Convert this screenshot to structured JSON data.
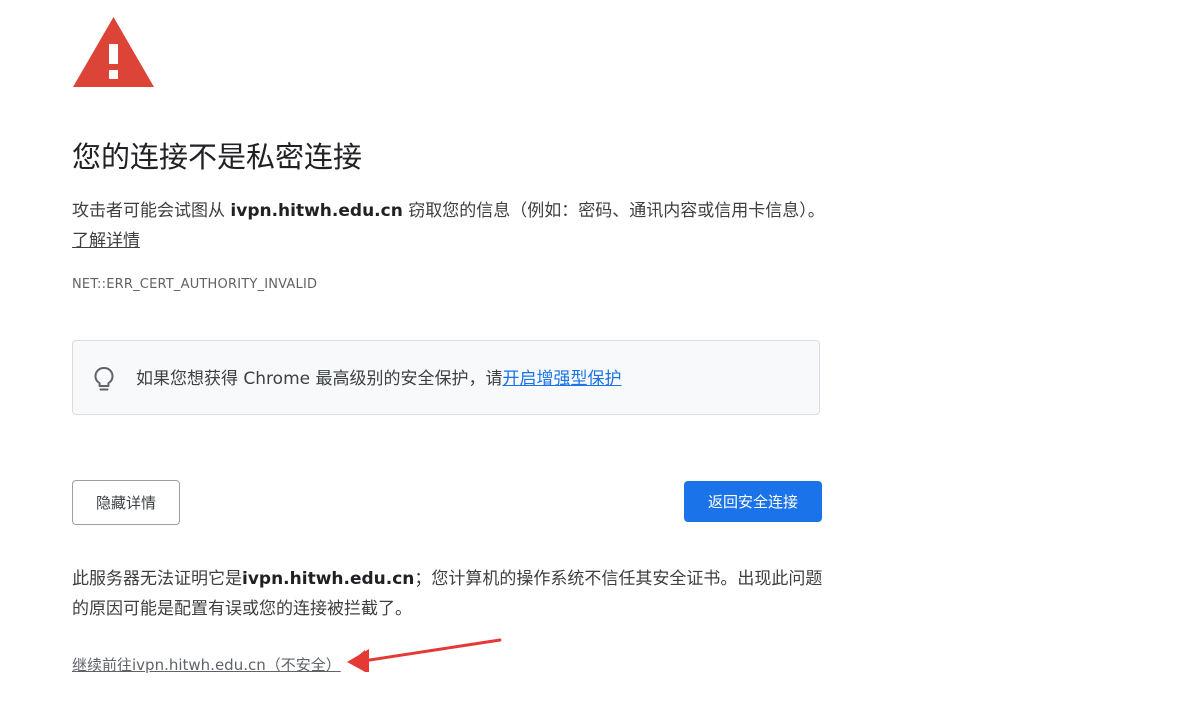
{
  "interstitial": {
    "heading": "您的连接不是私密连接",
    "explanation_prefix": "攻击者可能会试图从 ",
    "domain": "ivpn.hitwh.edu.cn",
    "explanation_suffix": " 窃取您的信息（例如：密码、通讯内容或信用卡信息）。",
    "learn_more": "了解详情",
    "error_code": "NET::ERR_CERT_AUTHORITY_INVALID"
  },
  "enhanced_protection": {
    "text": "如果您想获得 Chrome 最高级别的安全保护，请",
    "link": "开启增强型保护"
  },
  "buttons": {
    "hide_details": "隐藏详情",
    "back_to_safety": "返回安全连接"
  },
  "details": {
    "prefix": "此服务器无法证明它是",
    "domain": "ivpn.hitwh.edu.cn",
    "suffix": "；您计算机的操作系统不信任其安全证书。出现此问题的原因可能是配置有误或您的连接被拦截了。",
    "proceed_link": "继续前往ivpn.hitwh.edu.cn（不安全）"
  },
  "colors": {
    "warning_red": "#db4437",
    "link_blue": "#1a73e8",
    "primary_button": "#1a73e8",
    "annotation_arrow": "#e53935"
  },
  "icons": {
    "warning": "warning-triangle-icon",
    "bulb": "lightbulb-icon"
  }
}
